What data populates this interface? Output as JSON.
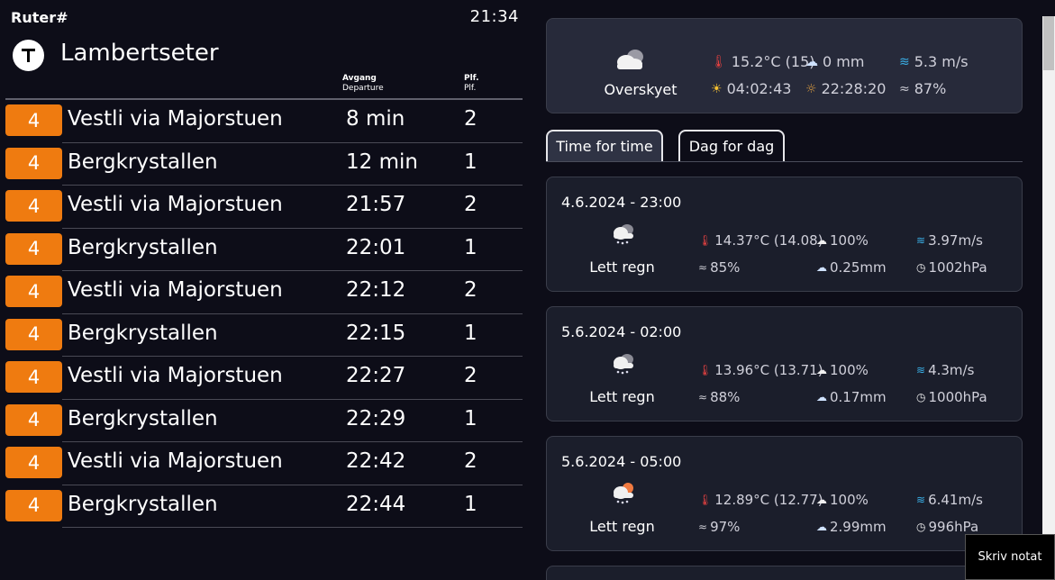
{
  "header": {
    "brand": "Ruter#",
    "clock": "21:34",
    "stop_name": "Lambertseter"
  },
  "columns": {
    "departure_no": "Avgang",
    "departure_en": "Departure",
    "platform_no": "Plf.",
    "platform_en": "Plf."
  },
  "departures": [
    {
      "line": "4",
      "destination": "Vestli via Majorstuen",
      "time": "8 min",
      "platform": "2"
    },
    {
      "line": "4",
      "destination": "Bergkrystallen",
      "time": "12 min",
      "platform": "1"
    },
    {
      "line": "4",
      "destination": "Vestli via Majorstuen",
      "time": "21:57",
      "platform": "2"
    },
    {
      "line": "4",
      "destination": "Bergkrystallen",
      "time": "22:01",
      "platform": "1"
    },
    {
      "line": "4",
      "destination": "Vestli via Majorstuen",
      "time": "22:12",
      "platform": "2"
    },
    {
      "line": "4",
      "destination": "Bergkrystallen",
      "time": "22:15",
      "platform": "1"
    },
    {
      "line": "4",
      "destination": "Vestli via Majorstuen",
      "time": "22:27",
      "platform": "2"
    },
    {
      "line": "4",
      "destination": "Bergkrystallen",
      "time": "22:29",
      "platform": "1"
    },
    {
      "line": "4",
      "destination": "Vestli via Majorstuen",
      "time": "22:42",
      "platform": "2"
    },
    {
      "line": "4",
      "destination": "Bergkrystallen",
      "time": "22:44",
      "platform": "1"
    }
  ],
  "current_weather": {
    "condition": "Overskyet",
    "temperature": "15.2°C (15)",
    "precipitation": "0 mm",
    "wind": "5.3 m/s",
    "sunrise": "04:02:43",
    "sunset": "22:28:20",
    "humidity": "87%"
  },
  "tabs": {
    "hourly": "Time for time",
    "daily": "Dag for dag"
  },
  "forecast": [
    {
      "datetime": "4.6.2024 - 23:00",
      "condition": "Lett regn",
      "temperature": "14.37°C (14.08)",
      "cloud": "100%",
      "wind": "3.97m/s",
      "humidity": "85%",
      "precipitation": "0.25mm",
      "pressure": "1002hPa"
    },
    {
      "datetime": "5.6.2024 - 02:00",
      "condition": "Lett regn",
      "temperature": "13.96°C (13.71)",
      "cloud": "100%",
      "wind": "4.3m/s",
      "humidity": "88%",
      "precipitation": "0.17mm",
      "pressure": "1000hPa"
    },
    {
      "datetime": "5.6.2024 - 05:00",
      "condition": "Lett regn",
      "temperature": "12.89°C (12.77)",
      "cloud": "100%",
      "wind": "6.41m/s",
      "humidity": "97%",
      "precipitation": "2.99mm",
      "pressure": "996hPa"
    }
  ],
  "note_button": "Skriv notat",
  "colors": {
    "line_badge": "#ef7b10",
    "background": "#0d0d18",
    "card": "#1b1e2b"
  }
}
